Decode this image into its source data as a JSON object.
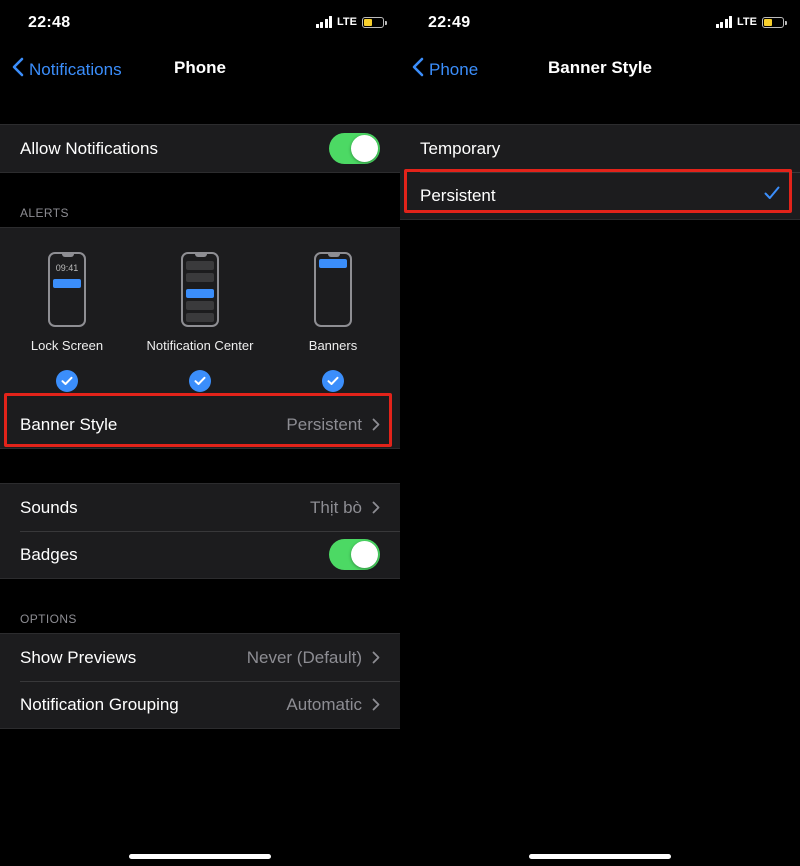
{
  "left": {
    "status": {
      "time": "22:48",
      "network": "LTE",
      "battery_level": 0.45
    },
    "nav": {
      "back_label": "Notifications",
      "title": "Phone"
    },
    "allow_notifications": {
      "label": "Allow Notifications",
      "on": true
    },
    "alerts": {
      "header": "ALERTS",
      "options": [
        {
          "label": "Lock Screen",
          "checked": true,
          "preview_time": "09:41"
        },
        {
          "label": "Notification Center",
          "checked": true
        },
        {
          "label": "Banners",
          "checked": true
        }
      ]
    },
    "banner_style": {
      "label": "Banner Style",
      "value": "Persistent"
    },
    "sounds": {
      "label": "Sounds",
      "value": "Thịt bò"
    },
    "badges": {
      "label": "Badges",
      "on": true
    },
    "options": {
      "header": "OPTIONS",
      "show_previews": {
        "label": "Show Previews",
        "value": "Never (Default)"
      },
      "notification_grouping": {
        "label": "Notification Grouping",
        "value": "Automatic"
      }
    }
  },
  "right": {
    "status": {
      "time": "22:49",
      "network": "LTE",
      "battery_level": 0.45
    },
    "nav": {
      "back_label": "Phone",
      "title": "Banner Style"
    },
    "choices": [
      {
        "label": "Temporary",
        "selected": false
      },
      {
        "label": "Persistent",
        "selected": true
      }
    ]
  },
  "colors": {
    "accent": "#3b8efb",
    "toggle_on": "#4cd964",
    "highlight": "#e2231a",
    "cell_bg": "#1c1c1e",
    "secondary_text": "#8d8d93",
    "battery": "#f7cf2c"
  },
  "icons": [
    "chevron-left-icon",
    "chevron-right-icon",
    "checkmark-icon",
    "signal-icon",
    "battery-icon"
  ]
}
